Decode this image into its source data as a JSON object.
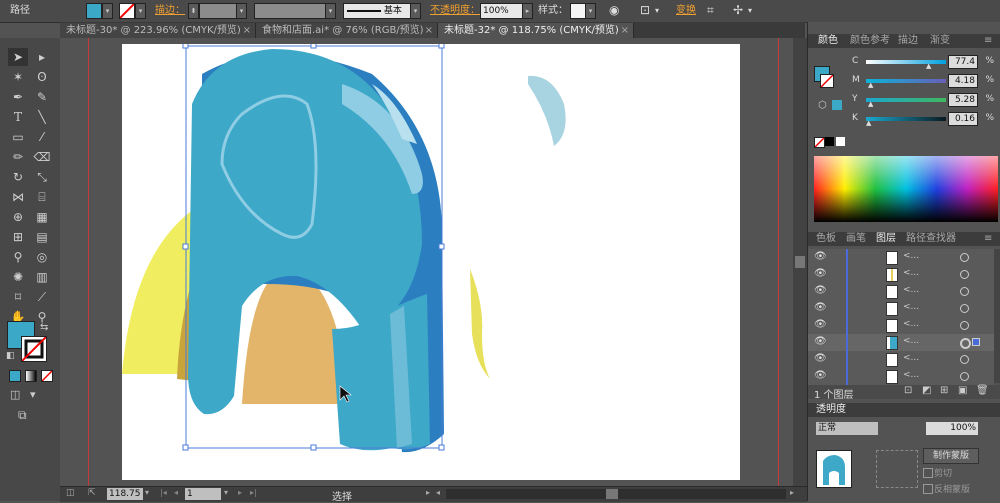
{
  "control_bar": {
    "title": "路径",
    "stroke_label": "描边：",
    "stroke_profile": "基本",
    "opacity_label": "不透明度：",
    "opacity_value": "100%",
    "style_label": "样式：",
    "transform_label": "变换",
    "fill_color": "#3ca8c8"
  },
  "tabs": [
    {
      "label": "未标题-30* @ 223.96% (CMYK/预览)"
    },
    {
      "label": "食物和店面.ai* @ 76% (RGB/预览)"
    },
    {
      "label": "未标题-32* @ 118.75% (CMYK/预览)"
    }
  ],
  "color_panel": {
    "tabs": [
      "颜色",
      "颜色参考",
      "描边",
      "渐变"
    ],
    "channels": [
      {
        "label": "C",
        "value": "77.4",
        "unit": "%"
      },
      {
        "label": "M",
        "value": "4.18",
        "unit": "%"
      },
      {
        "label": "Y",
        "value": "5.28",
        "unit": "%"
      },
      {
        "label": "K",
        "value": "0.16",
        "unit": "%"
      }
    ]
  },
  "layers_panel": {
    "tabs": [
      "色板",
      "画笔",
      "图层",
      "路径查找器"
    ],
    "rows": [
      "<...",
      "<...",
      "<...",
      "<...",
      "<...",
      "<...",
      "<...",
      "<..."
    ],
    "footer": "1 个图层"
  },
  "transparency_panel": {
    "title": "透明度",
    "mode": "正常",
    "opacity": "100%",
    "make_mask": "制作蒙版",
    "clip": "剪切",
    "invert": "反相蒙版"
  },
  "status_bar": {
    "zoom": "118.75",
    "page": "1",
    "tool": "选择"
  },
  "colors": {
    "elephant_main": "#3ea8c9",
    "elephant_dark": "#2b7ec0",
    "elephant_light": "#8ecde3",
    "yellow": "#f0ee60",
    "tan": "#e3b56a",
    "ochre": "#c9a43a"
  }
}
